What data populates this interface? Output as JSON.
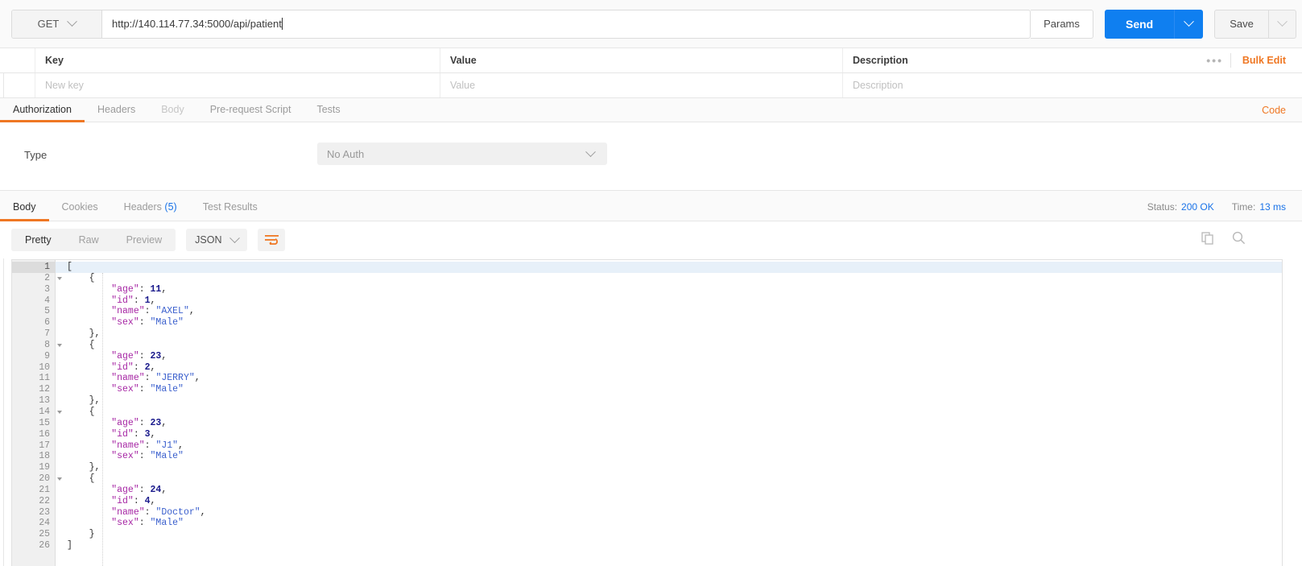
{
  "request": {
    "method": "GET",
    "url": "http://140.114.77.34:5000/api/patient",
    "params_label": "Params",
    "send_label": "Send",
    "save_label": "Save"
  },
  "params_table": {
    "columns": [
      "Key",
      "Value",
      "Description"
    ],
    "placeholder_row": [
      "New key",
      "Value",
      "Description"
    ],
    "bulk_edit_label": "Bulk Edit",
    "more_label": "•••"
  },
  "request_tabs": {
    "items": [
      {
        "label": "Authorization",
        "state": "active"
      },
      {
        "label": "Headers",
        "state": "normal"
      },
      {
        "label": "Body",
        "state": "disabled"
      },
      {
        "label": "Pre-request Script",
        "state": "normal"
      },
      {
        "label": "Tests",
        "state": "normal"
      }
    ],
    "code_label": "Code"
  },
  "auth": {
    "type_label": "Type",
    "type_value": "No Auth"
  },
  "response_tabs": {
    "items": [
      {
        "label": "Body",
        "count": "",
        "state": "active"
      },
      {
        "label": "Cookies",
        "count": "",
        "state": "normal"
      },
      {
        "label": "Headers",
        "count": "(5)",
        "state": "normal"
      },
      {
        "label": "Test Results",
        "count": "",
        "state": "normal"
      }
    ],
    "status_label": "Status:",
    "status_value": "200 OK",
    "time_label": "Time:",
    "time_value": "13 ms"
  },
  "body_toolbar": {
    "view_modes": [
      {
        "label": "Pretty",
        "state": "active"
      },
      {
        "label": "Raw",
        "state": "normal"
      },
      {
        "label": "Preview",
        "state": "normal"
      }
    ],
    "format": "JSON",
    "wrap_icon": "word-wrap-icon",
    "copy_icon": "copy-icon",
    "search_icon": "search-icon"
  },
  "response_body": {
    "lines": [
      {
        "no": "1",
        "fold": true,
        "active": true,
        "tokens": [
          {
            "t": "p",
            "v": "["
          }
        ]
      },
      {
        "no": "2",
        "fold": true,
        "active": false,
        "tokens": [
          {
            "t": "p",
            "v": "    {"
          }
        ]
      },
      {
        "no": "3",
        "fold": false,
        "active": false,
        "tokens": [
          {
            "t": "k",
            "v": "        \"age\""
          },
          {
            "t": "p",
            "v": ": "
          },
          {
            "t": "n",
            "v": "11"
          },
          {
            "t": "p",
            "v": ","
          }
        ]
      },
      {
        "no": "4",
        "fold": false,
        "active": false,
        "tokens": [
          {
            "t": "k",
            "v": "        \"id\""
          },
          {
            "t": "p",
            "v": ": "
          },
          {
            "t": "n",
            "v": "1"
          },
          {
            "t": "p",
            "v": ","
          }
        ]
      },
      {
        "no": "5",
        "fold": false,
        "active": false,
        "tokens": [
          {
            "t": "k",
            "v": "        \"name\""
          },
          {
            "t": "p",
            "v": ": "
          },
          {
            "t": "s",
            "v": "\"AXEL\""
          },
          {
            "t": "p",
            "v": ","
          }
        ]
      },
      {
        "no": "6",
        "fold": false,
        "active": false,
        "tokens": [
          {
            "t": "k",
            "v": "        \"sex\""
          },
          {
            "t": "p",
            "v": ": "
          },
          {
            "t": "s",
            "v": "\"Male\""
          }
        ]
      },
      {
        "no": "7",
        "fold": false,
        "active": false,
        "tokens": [
          {
            "t": "p",
            "v": "    },"
          }
        ]
      },
      {
        "no": "8",
        "fold": true,
        "active": false,
        "tokens": [
          {
            "t": "p",
            "v": "    {"
          }
        ]
      },
      {
        "no": "9",
        "fold": false,
        "active": false,
        "tokens": [
          {
            "t": "k",
            "v": "        \"age\""
          },
          {
            "t": "p",
            "v": ": "
          },
          {
            "t": "n",
            "v": "23"
          },
          {
            "t": "p",
            "v": ","
          }
        ]
      },
      {
        "no": "10",
        "fold": false,
        "active": false,
        "tokens": [
          {
            "t": "k",
            "v": "        \"id\""
          },
          {
            "t": "p",
            "v": ": "
          },
          {
            "t": "n",
            "v": "2"
          },
          {
            "t": "p",
            "v": ","
          }
        ]
      },
      {
        "no": "11",
        "fold": false,
        "active": false,
        "tokens": [
          {
            "t": "k",
            "v": "        \"name\""
          },
          {
            "t": "p",
            "v": ": "
          },
          {
            "t": "s",
            "v": "\"JERRY\""
          },
          {
            "t": "p",
            "v": ","
          }
        ]
      },
      {
        "no": "12",
        "fold": false,
        "active": false,
        "tokens": [
          {
            "t": "k",
            "v": "        \"sex\""
          },
          {
            "t": "p",
            "v": ": "
          },
          {
            "t": "s",
            "v": "\"Male\""
          }
        ]
      },
      {
        "no": "13",
        "fold": false,
        "active": false,
        "tokens": [
          {
            "t": "p",
            "v": "    },"
          }
        ]
      },
      {
        "no": "14",
        "fold": true,
        "active": false,
        "tokens": [
          {
            "t": "p",
            "v": "    {"
          }
        ]
      },
      {
        "no": "15",
        "fold": false,
        "active": false,
        "tokens": [
          {
            "t": "k",
            "v": "        \"age\""
          },
          {
            "t": "p",
            "v": ": "
          },
          {
            "t": "n",
            "v": "23"
          },
          {
            "t": "p",
            "v": ","
          }
        ]
      },
      {
        "no": "16",
        "fold": false,
        "active": false,
        "tokens": [
          {
            "t": "k",
            "v": "        \"id\""
          },
          {
            "t": "p",
            "v": ": "
          },
          {
            "t": "n",
            "v": "3"
          },
          {
            "t": "p",
            "v": ","
          }
        ]
      },
      {
        "no": "17",
        "fold": false,
        "active": false,
        "tokens": [
          {
            "t": "k",
            "v": "        \"name\""
          },
          {
            "t": "p",
            "v": ": "
          },
          {
            "t": "s",
            "v": "\"J1\""
          },
          {
            "t": "p",
            "v": ","
          }
        ]
      },
      {
        "no": "18",
        "fold": false,
        "active": false,
        "tokens": [
          {
            "t": "k",
            "v": "        \"sex\""
          },
          {
            "t": "p",
            "v": ": "
          },
          {
            "t": "s",
            "v": "\"Male\""
          }
        ]
      },
      {
        "no": "19",
        "fold": false,
        "active": false,
        "tokens": [
          {
            "t": "p",
            "v": "    },"
          }
        ]
      },
      {
        "no": "20",
        "fold": true,
        "active": false,
        "tokens": [
          {
            "t": "p",
            "v": "    {"
          }
        ]
      },
      {
        "no": "21",
        "fold": false,
        "active": false,
        "tokens": [
          {
            "t": "k",
            "v": "        \"age\""
          },
          {
            "t": "p",
            "v": ": "
          },
          {
            "t": "n",
            "v": "24"
          },
          {
            "t": "p",
            "v": ","
          }
        ]
      },
      {
        "no": "22",
        "fold": false,
        "active": false,
        "tokens": [
          {
            "t": "k",
            "v": "        \"id\""
          },
          {
            "t": "p",
            "v": ": "
          },
          {
            "t": "n",
            "v": "4"
          },
          {
            "t": "p",
            "v": ","
          }
        ]
      },
      {
        "no": "23",
        "fold": false,
        "active": false,
        "tokens": [
          {
            "t": "k",
            "v": "        \"name\""
          },
          {
            "t": "p",
            "v": ": "
          },
          {
            "t": "s",
            "v": "\"Doctor\""
          },
          {
            "t": "p",
            "v": ","
          }
        ]
      },
      {
        "no": "24",
        "fold": false,
        "active": false,
        "tokens": [
          {
            "t": "k",
            "v": "        \"sex\""
          },
          {
            "t": "p",
            "v": ": "
          },
          {
            "t": "s",
            "v": "\"Male\""
          }
        ]
      },
      {
        "no": "25",
        "fold": false,
        "active": false,
        "tokens": [
          {
            "t": "p",
            "v": "    }"
          }
        ]
      },
      {
        "no": "26",
        "fold": false,
        "active": false,
        "tokens": [
          {
            "t": "p",
            "v": "]"
          }
        ]
      }
    ]
  },
  "colors": {
    "accent_orange": "#ef7723",
    "send_blue": "#0f7ff0",
    "status_blue": "#1a73e8"
  }
}
